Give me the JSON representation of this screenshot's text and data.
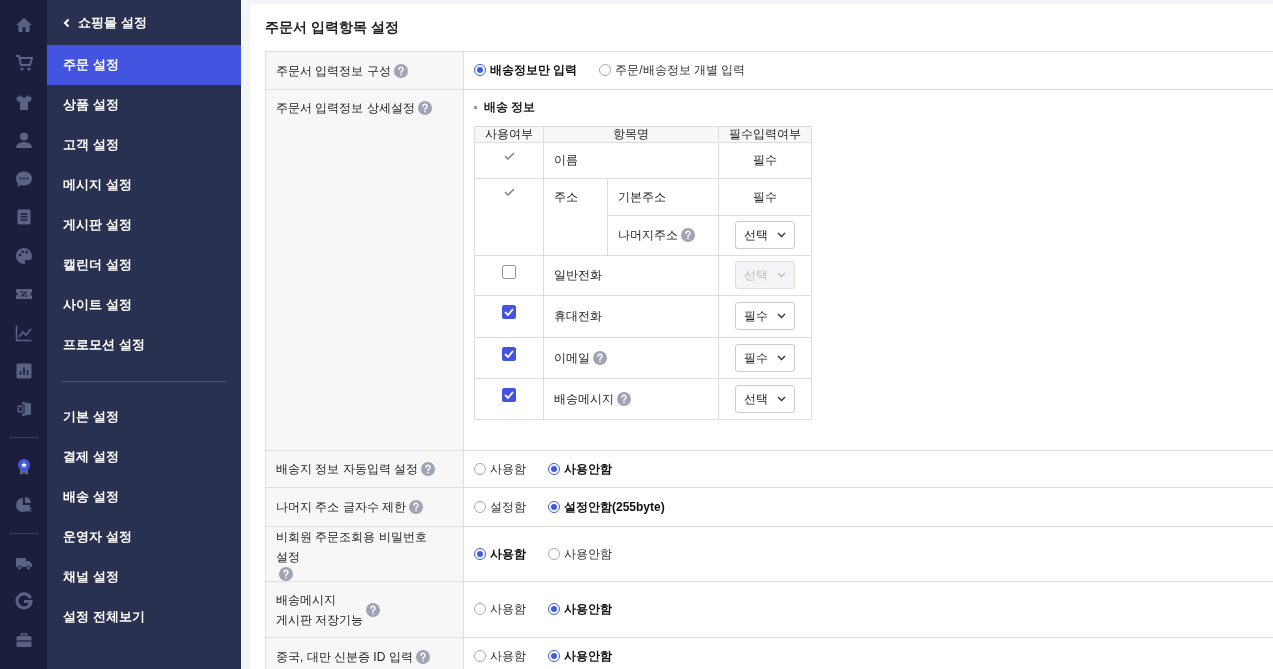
{
  "sidebar": {
    "back_label": "쇼핑몰 설정",
    "groups": [
      {
        "items": [
          {
            "label": "주문 설정",
            "selected": true
          },
          {
            "label": "상품 설정",
            "selected": false
          },
          {
            "label": "고객 설정",
            "selected": false
          },
          {
            "label": "메시지 설정",
            "selected": false
          },
          {
            "label": "게시판 설정",
            "selected": false
          },
          {
            "label": "캘린더 설정",
            "selected": false
          },
          {
            "label": "사이트 설정",
            "selected": false
          },
          {
            "label": "프로모션 설정",
            "selected": false
          }
        ]
      },
      {
        "items": [
          {
            "label": "기본 설정",
            "selected": false
          },
          {
            "label": "결제 설정",
            "selected": false
          },
          {
            "label": "배송 설정",
            "selected": false
          },
          {
            "label": "운영자 설정",
            "selected": false
          },
          {
            "label": "채널 설정",
            "selected": false
          },
          {
            "label": "설정 전체보기",
            "selected": false
          }
        ]
      }
    ]
  },
  "page_title": "주문서 입력항목 설정",
  "settings": [
    {
      "kind": "radio",
      "label": "주문서 입력정보 구성",
      "help": true,
      "options": [
        {
          "label": "배송정보만 입력",
          "selected": true
        },
        {
          "label": "주문/배송정보 개별 입력",
          "selected": false
        }
      ]
    },
    {
      "kind": "fields",
      "label": "주문서 입력정보 상세설정",
      "help": true,
      "section_title": "배송 정보",
      "columns": [
        "사용여부",
        "항목명",
        "필수입력여부"
      ],
      "rows": [
        {
          "usage": {
            "kind": "fixed"
          },
          "name": "이름",
          "help": false,
          "required": {
            "kind": "text",
            "text": "필수"
          }
        },
        {
          "usage": {
            "kind": "fixed"
          },
          "name": "주소",
          "help": false,
          "subitems": [
            {
              "name": "기본주소",
              "help": false,
              "required": {
                "kind": "text",
                "text": "필수"
              }
            },
            {
              "name": "나머지주소",
              "help": true,
              "required": {
                "kind": "select",
                "value": "선택",
                "disabled": false
              }
            }
          ]
        },
        {
          "usage": {
            "kind": "checkbox",
            "checked": false
          },
          "name": "일반전화",
          "help": false,
          "required": {
            "kind": "select",
            "value": "선택",
            "disabled": true
          }
        },
        {
          "usage": {
            "kind": "checkbox",
            "checked": true
          },
          "name": "휴대전화",
          "help": false,
          "required": {
            "kind": "select",
            "value": "필수",
            "disabled": false
          }
        },
        {
          "usage": {
            "kind": "checkbox",
            "checked": true
          },
          "name": "이메일",
          "help": true,
          "required": {
            "kind": "select",
            "value": "필수",
            "disabled": false
          }
        },
        {
          "usage": {
            "kind": "checkbox",
            "checked": true
          },
          "name": "배송메시지",
          "help": true,
          "required": {
            "kind": "select",
            "value": "선택",
            "disabled": false
          }
        }
      ]
    },
    {
      "kind": "radio",
      "label": "배송지 정보 자동입력 설정",
      "help": true,
      "options": [
        {
          "label": "사용함",
          "selected": false
        },
        {
          "label": "사용안함",
          "selected": true
        }
      ]
    },
    {
      "kind": "radio",
      "label": "나머지 주소 글자수 제한",
      "help": true,
      "options": [
        {
          "label": "설정함",
          "selected": false
        },
        {
          "label": "설정안함(255byte)",
          "selected": true
        }
      ]
    },
    {
      "kind": "radio",
      "label": "비회원 주문조회용 비밀번호 설정",
      "help": true,
      "options": [
        {
          "label": "사용함",
          "selected": true
        },
        {
          "label": "사용안함",
          "selected": false
        }
      ]
    },
    {
      "kind": "radio",
      "label": "배송메시지\n게시판 저장기능",
      "help": true,
      "options": [
        {
          "label": "사용함",
          "selected": false
        },
        {
          "label": "사용안함",
          "selected": true
        }
      ]
    },
    {
      "kind": "radio",
      "label": "중국, 대만 신분증 ID 입력",
      "help": true,
      "options": [
        {
          "label": "사용함",
          "selected": false
        },
        {
          "label": "사용안함",
          "selected": true
        }
      ]
    }
  ]
}
